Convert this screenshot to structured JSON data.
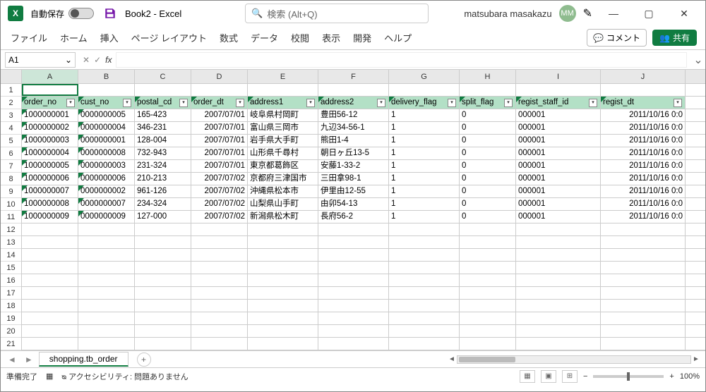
{
  "titlebar": {
    "autosave": "自動保存",
    "autosave_off": "オフ",
    "title": "Book2 - Excel",
    "search_placeholder": "検索 (Alt+Q)",
    "user": "matsubara masakazu",
    "avatar": "MM"
  },
  "ribbon": {
    "tabs": [
      "ファイル",
      "ホーム",
      "挿入",
      "ページ レイアウト",
      "数式",
      "データ",
      "校閲",
      "表示",
      "開発",
      "ヘルプ"
    ],
    "comment": "コメント",
    "share": "共有"
  },
  "namebox": "A1",
  "columns": [
    "A",
    "B",
    "C",
    "D",
    "E",
    "F",
    "G",
    "H",
    "I",
    "J"
  ],
  "headers": [
    "order_no",
    "cust_no",
    "postal_cd",
    "order_dt",
    "address1",
    "address2",
    "delivery_flag",
    "split_flag",
    "regist_staff_id",
    "regist_dt"
  ],
  "rows": [
    [
      "1000000001",
      "0000000005",
      "165-423",
      "2007/07/01",
      "岐阜県村岡町",
      "豊田56-12",
      "1",
      "0",
      "000001",
      "2011/10/16 0:0"
    ],
    [
      "1000000002",
      "0000000004",
      "346-231",
      "2007/07/01",
      "富山県三岡市",
      "九辺34-56-1",
      "1",
      "0",
      "000001",
      "2011/10/16 0:0"
    ],
    [
      "1000000003",
      "0000000001",
      "128-004",
      "2007/07/01",
      "岩手県大手町",
      "熊田1-4",
      "1",
      "0",
      "000001",
      "2011/10/16 0:0"
    ],
    [
      "1000000004",
      "0000000008",
      "732-943",
      "2007/07/01",
      "山形県千尋村",
      "朝日ヶ丘13-5",
      "1",
      "0",
      "000001",
      "2011/10/16 0:0"
    ],
    [
      "1000000005",
      "0000000003",
      "231-324",
      "2007/07/01",
      "東京都葛飾区",
      "安藤1-33-2",
      "1",
      "0",
      "000001",
      "2011/10/16 0:0"
    ],
    [
      "1000000006",
      "0000000006",
      "210-213",
      "2007/07/02",
      "京都府三津国市",
      "三田拿98-1",
      "1",
      "0",
      "000001",
      "2011/10/16 0:0"
    ],
    [
      "1000000007",
      "0000000002",
      "961-126",
      "2007/07/02",
      "沖縄県松本市",
      "伊里由12-55",
      "1",
      "0",
      "000001",
      "2011/10/16 0:0"
    ],
    [
      "1000000008",
      "0000000007",
      "234-324",
      "2007/07/02",
      "山梨県山手町",
      "由卯54-13",
      "1",
      "0",
      "000001",
      "2011/10/16 0:0"
    ],
    [
      "1000000009",
      "0000000009",
      "127-000",
      "2007/07/02",
      "新潟県松木町",
      "長府56-2",
      "1",
      "0",
      "000001",
      "2011/10/16 0:0"
    ]
  ],
  "sheet": {
    "name": "shopping.tb_order"
  },
  "status": {
    "ready": "準備完了",
    "accessibility": "アクセシビリティ: 問題ありません",
    "zoom": "100%"
  }
}
